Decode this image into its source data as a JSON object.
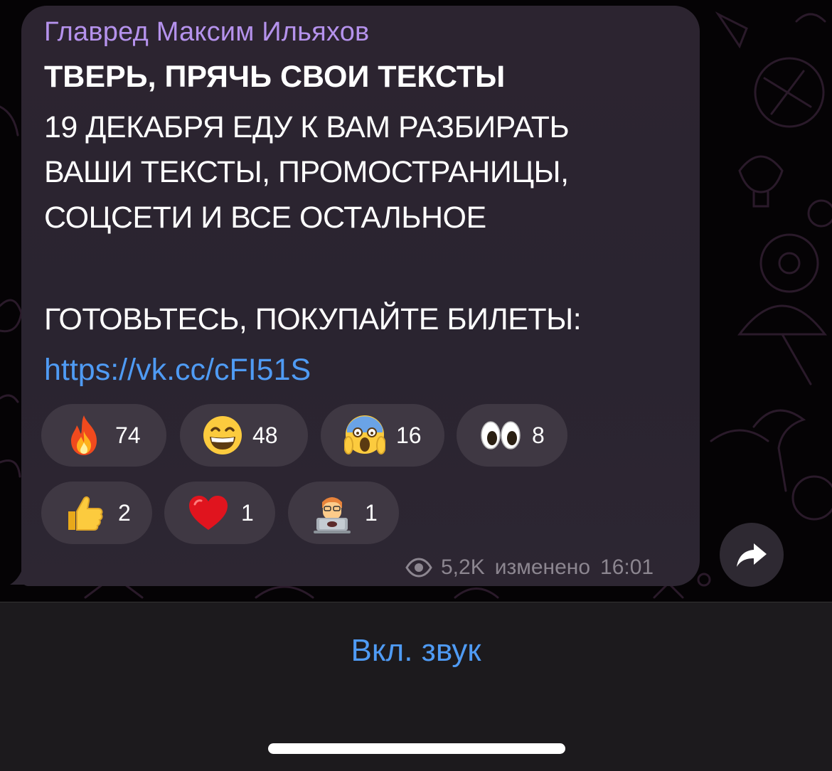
{
  "message": {
    "author": "Главред Максим Ильяхов",
    "title": "ТВЕРЬ, ПРЯЧЬ СВОИ ТЕКСТЫ",
    "lines": [
      "19 ДЕКАБРЯ ЕДУ К ВАМ РАЗБИРАТЬ",
      "ВАШИ ТЕКСТЫ, ПРОМОСТРАНИЦЫ,",
      "СОЦСЕТИ И ВСЕ ОСТАЛЬНОЕ",
      "ГОТОВЬТЕСЬ, ПОКУПАЙТЕ БИЛЕТЫ:"
    ],
    "link": "https://vk.cc/cFI51S",
    "views": "5,2K",
    "edited_label": "изменено",
    "time": "16:01"
  },
  "reactions": [
    {
      "icon": "fire-emoji",
      "count": "74"
    },
    {
      "icon": "grinning-face-emoji",
      "count": "48"
    },
    {
      "icon": "screaming-face-emoji",
      "count": "16"
    },
    {
      "icon": "eyes-emoji",
      "count": "8"
    },
    {
      "icon": "thumbs-up-emoji",
      "count": "2"
    },
    {
      "icon": "red-heart-emoji",
      "count": "1"
    },
    {
      "icon": "technologist-emoji",
      "count": "1"
    }
  ],
  "bottom": {
    "sound_button": "Вкл. звук"
  },
  "colors": {
    "author": "#b592ec",
    "link": "#4f9bf4",
    "bubble": "#2c2430",
    "reaction_pill": "#3f3843"
  }
}
